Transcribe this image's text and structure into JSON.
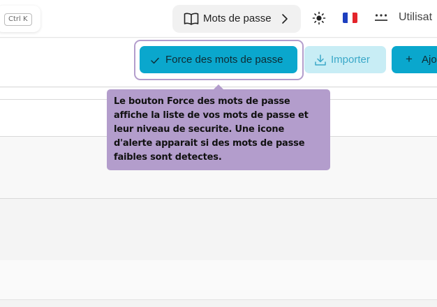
{
  "header": {
    "shortcut": "Ctrl K",
    "docs_label": "Mots de passe",
    "user_label": "Utilisat",
    "icons": {
      "docs": "book-icon",
      "chevron": "chevron-right-icon",
      "theme": "sun-icon",
      "language": "flag-fr-icon",
      "passwords": "password-dots-icon"
    }
  },
  "toolbar": {
    "force_label": "Force des mots de passe",
    "import_label": "Importer",
    "add_label": "Ajo",
    "add_symbol": "+"
  },
  "tooltip": {
    "text": "Le bouton Force des mots de passe affiche la liste de vos mots de passe et leur niveau de securite. Une icone d'alerte apparait si des mots de passe faibles sont detectes."
  },
  "colors": {
    "accent": "#0aa7cd",
    "accent_light": "#c8edf5",
    "tooltip_bg": "#b39dcc",
    "flag": [
      "#1d3fbf",
      "#ffffff",
      "#e3242b"
    ]
  }
}
